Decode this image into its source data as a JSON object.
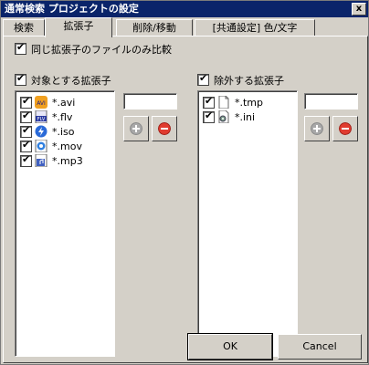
{
  "window": {
    "title": "通常検索 プロジェクトの設定",
    "close_label": "x"
  },
  "tabs": [
    {
      "label": "検索",
      "active": false
    },
    {
      "label": "拡張子",
      "active": true
    },
    {
      "label": "削除/移動",
      "active": false
    },
    {
      "label": "[共通設定] 色/文字",
      "active": false
    }
  ],
  "options": {
    "same_ext_only": "同じ拡張子のファイルのみ比較"
  },
  "include": {
    "title": "対象とする拡張子",
    "items": [
      "*.avi",
      "*.flv",
      "*.iso",
      "*.mov",
      "*.mp3"
    ],
    "input_value": ""
  },
  "exclude": {
    "title": "除外する拡張子",
    "items": [
      "*.tmp",
      "*.ini"
    ],
    "input_value": ""
  },
  "icons": {
    "add": "plus-icon",
    "remove": "minus-icon",
    "colors": {
      "remove": "#e03b2f",
      "add": "#a8a8a8",
      "accent": "#0a246a"
    }
  },
  "buttons": {
    "ok": "OK",
    "cancel": "Cancel"
  }
}
